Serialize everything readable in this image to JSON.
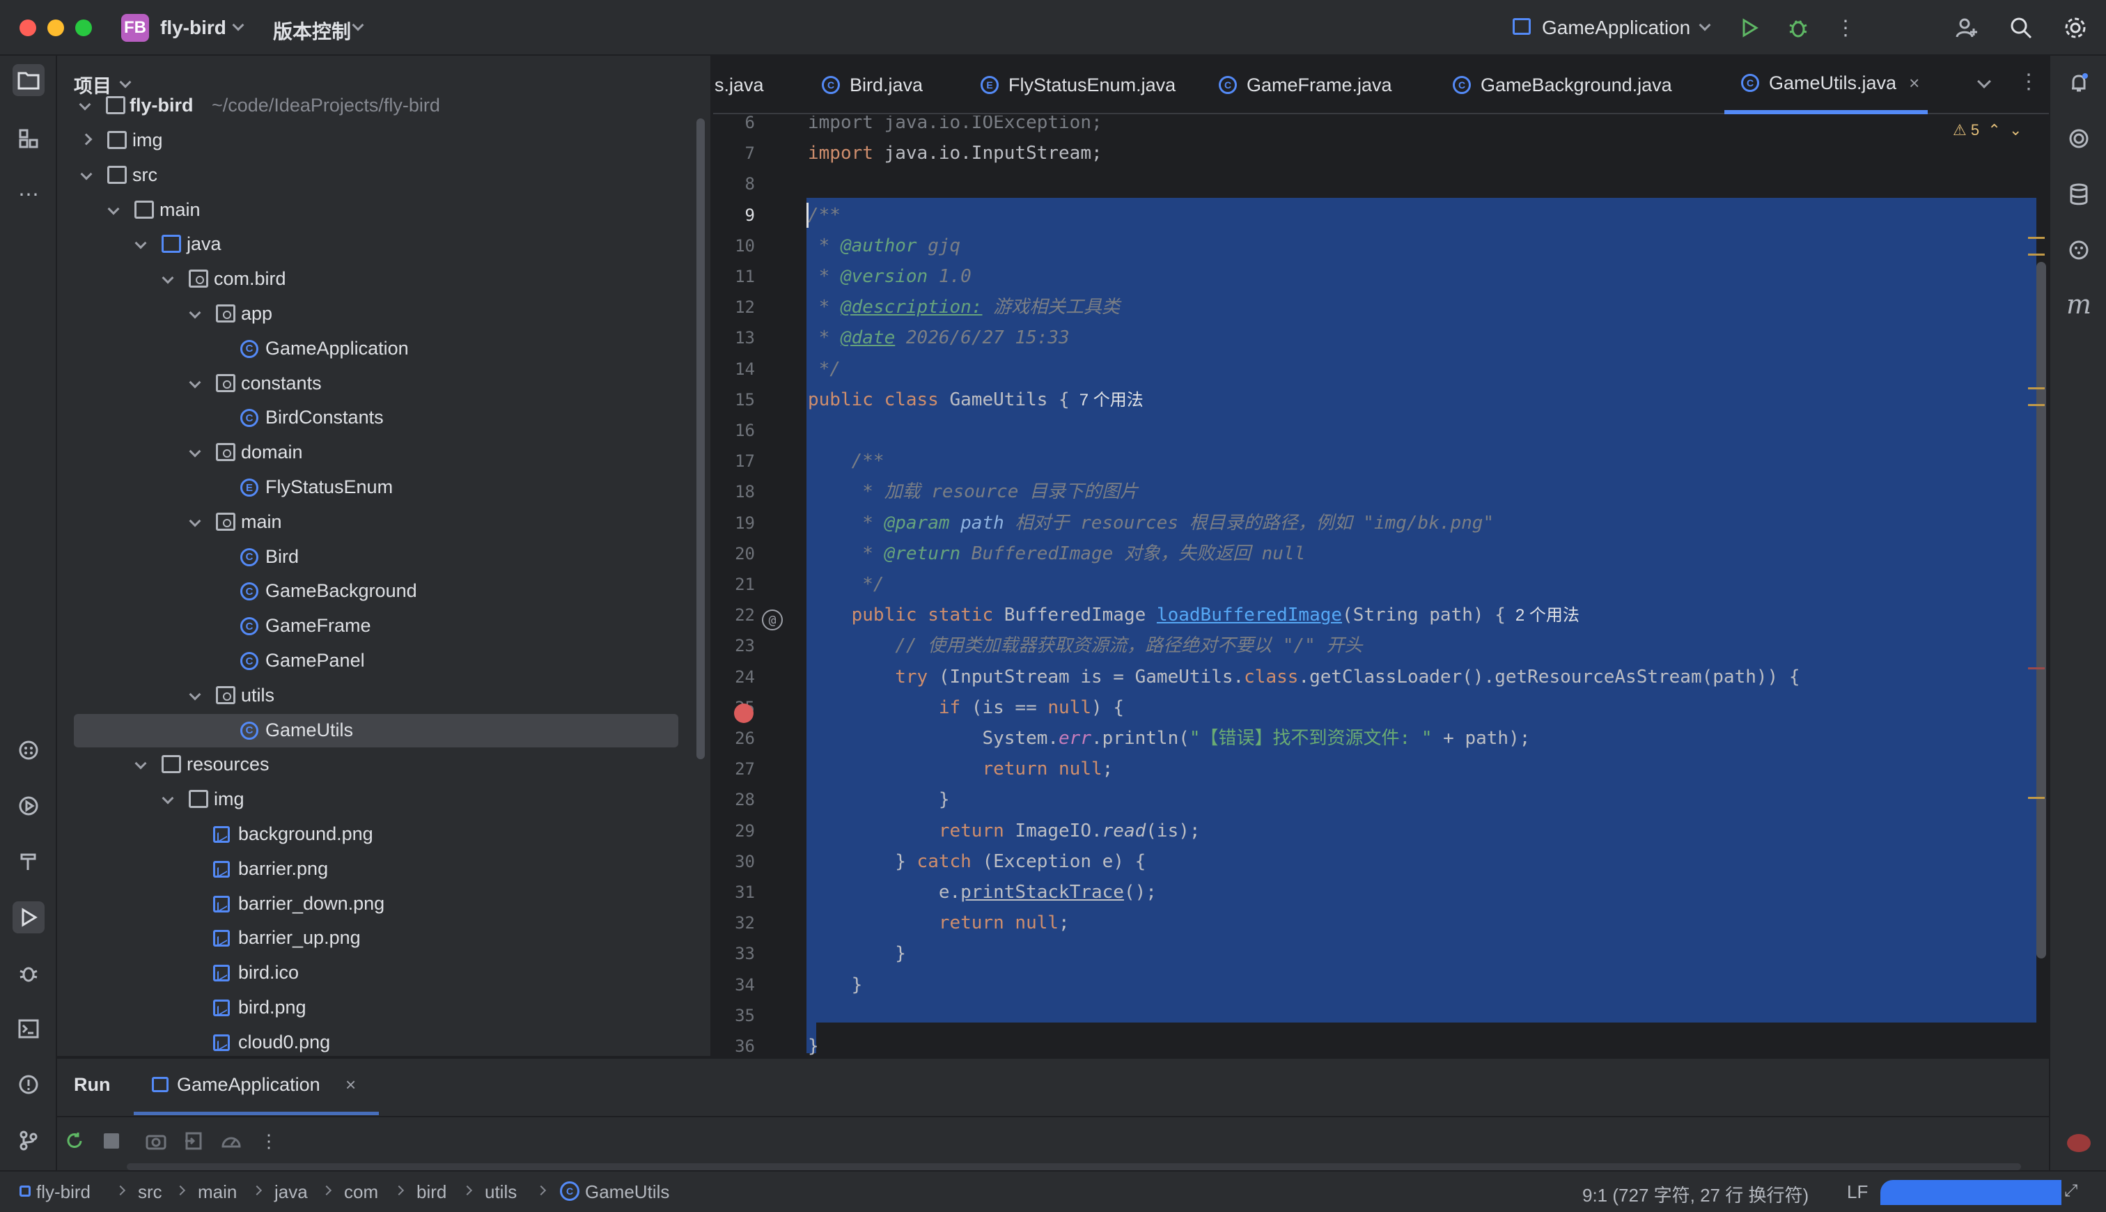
{
  "titlebar": {
    "project_badge": "FB",
    "project_name": "fly-bird",
    "vcs_label": "版本控制",
    "run_config": "GameApplication"
  },
  "project_panel": {
    "title": "项目",
    "root_label": "fly-bird",
    "root_path": "~/code/IdeaProjects/fly-bird",
    "rows": [
      {
        "label": "img",
        "icon": "folder-icon"
      },
      {
        "label": "src",
        "icon": "folder-icon"
      },
      {
        "label": "main",
        "icon": "folder-icon"
      },
      {
        "label": "java",
        "icon": "source-folder-icon"
      },
      {
        "label": "com.bird",
        "icon": "package-icon"
      },
      {
        "label": "app",
        "icon": "package-icon"
      },
      {
        "label": "GameApplication",
        "icon": "class-icon"
      },
      {
        "label": "constants",
        "icon": "package-icon"
      },
      {
        "label": "BirdConstants",
        "icon": "class-icon"
      },
      {
        "label": "domain",
        "icon": "package-icon"
      },
      {
        "label": "FlyStatusEnum",
        "icon": "enum-icon"
      },
      {
        "label": "main",
        "icon": "package-icon"
      },
      {
        "label": "Bird",
        "icon": "class-icon"
      },
      {
        "label": "GameBackground",
        "icon": "class-icon"
      },
      {
        "label": "GameFrame",
        "icon": "class-icon"
      },
      {
        "label": "GamePanel",
        "icon": "class-icon"
      },
      {
        "label": "utils",
        "icon": "package-icon"
      },
      {
        "label": "GameUtils",
        "icon": "class-icon"
      },
      {
        "label": "resources",
        "icon": "resources-folder-icon"
      },
      {
        "label": "img",
        "icon": "folder-icon"
      },
      {
        "label": "background.png",
        "icon": "image-file-icon"
      },
      {
        "label": "barrier.png",
        "icon": "image-file-icon"
      },
      {
        "label": "barrier_down.png",
        "icon": "image-file-icon"
      },
      {
        "label": "barrier_up.png",
        "icon": "image-file-icon"
      },
      {
        "label": "bird.ico",
        "icon": "image-file-icon"
      },
      {
        "label": "bird.png",
        "icon": "image-file-icon"
      },
      {
        "label": "cloud0.png",
        "icon": "image-file-icon"
      }
    ]
  },
  "tabs": [
    {
      "label": "s.java",
      "icon": ""
    },
    {
      "label": "Bird.java",
      "icon": "C"
    },
    {
      "label": "FlyStatusEnum.java",
      "icon": "E"
    },
    {
      "label": "GameFrame.java",
      "icon": "C"
    },
    {
      "label": "GameBackground.java",
      "icon": "C"
    },
    {
      "label": "GameUtils.java",
      "icon": "C",
      "active": true
    }
  ],
  "editor": {
    "warning_count": "5",
    "line_numbers": [
      "6",
      "7",
      "8",
      "9",
      "10",
      "11",
      "12",
      "13",
      "14",
      "15",
      "16",
      "17",
      "18",
      "19",
      "20",
      "21",
      "22",
      "23",
      "24",
      "25",
      "26",
      "27",
      "28",
      "29",
      "30",
      "31",
      "32",
      "33",
      "34",
      "35",
      "36"
    ],
    "lines": {
      "l6": "import java.io.IOException;",
      "l7_kw": "import",
      "l7_rest": " java.io.InputStream;",
      "l10_tag": "@author",
      "l10_val": " gjq",
      "l11_tag": "@version",
      "l11_val": " 1.0",
      "l12_tag": "@description:",
      "l12_val": " 游戏相关工具类",
      "l13_tag": "@date",
      "l13_val": " 2026/6/27 15:33",
      "l15_kw": "public class",
      "l15_name": " GameUtils {",
      "l15_hint": "7 个用法",
      "l18": "     * 加载 resource 目录下的图片",
      "l19_tag": "@param",
      "l19_name": " path",
      "l19_rest": " 相对于 resources 根目录的路径，例如 \"img/bk.png\"",
      "l20_tag": "@return",
      "l20_rest": " BufferedImage 对象，失败返回 null",
      "l22_kw": "public static",
      "l22_type": " BufferedImage ",
      "l22_fn": "loadBufferedImage",
      "l22_args": "(String path) {",
      "l22_hint": "2 个用法",
      "l23": "        // 使用类加载器获取资源流，路径绝对不要以 \"/\" 开头",
      "l24_kw": "try",
      "l24_a": " (InputStream is = GameUtils.",
      "l24_kw2": "class",
      "l24_b": ".getClassLoader().getResourceAsStream(path)) {",
      "l25_kw": "if",
      "l25_a": " (is == ",
      "l25_kw2": "null",
      "l25_b": ") {",
      "l26_a": "System.",
      "l26_err": "err",
      "l26_b": ".println(",
      "l26_str": "\"【错误】找不到资源文件: \"",
      "l26_c": " + path);",
      "l27_kw": "return null",
      "l29_kw": "return",
      "l29_a": " ImageIO.",
      "l29_read": "read",
      "l29_b": "(is);",
      "l30_kw": "catch",
      "l30_rest": " (Exception e) {",
      "l31_a": "e.",
      "l31_fn": "printStackTrace",
      "l31_b": "();",
      "l32_kw": "return null"
    }
  },
  "run_panel": {
    "title": "Run",
    "tab_label": "GameApplication"
  },
  "statusbar": {
    "breadcrumbs": [
      "fly-bird",
      "src",
      "main",
      "java",
      "com",
      "bird",
      "utils",
      "GameUtils"
    ],
    "position": "9:1 (727 字符, 27 行 换行符)",
    "line_sep": "LF"
  },
  "colors": {
    "accent": "#548af7",
    "selection": "#214283",
    "breakpoint": "#db5c5c",
    "keyword": "#cf8e6d",
    "comment": "#7a7e85",
    "doc_tag": "#67a37c",
    "string": "#6aab73",
    "method": "#56a8f5"
  }
}
